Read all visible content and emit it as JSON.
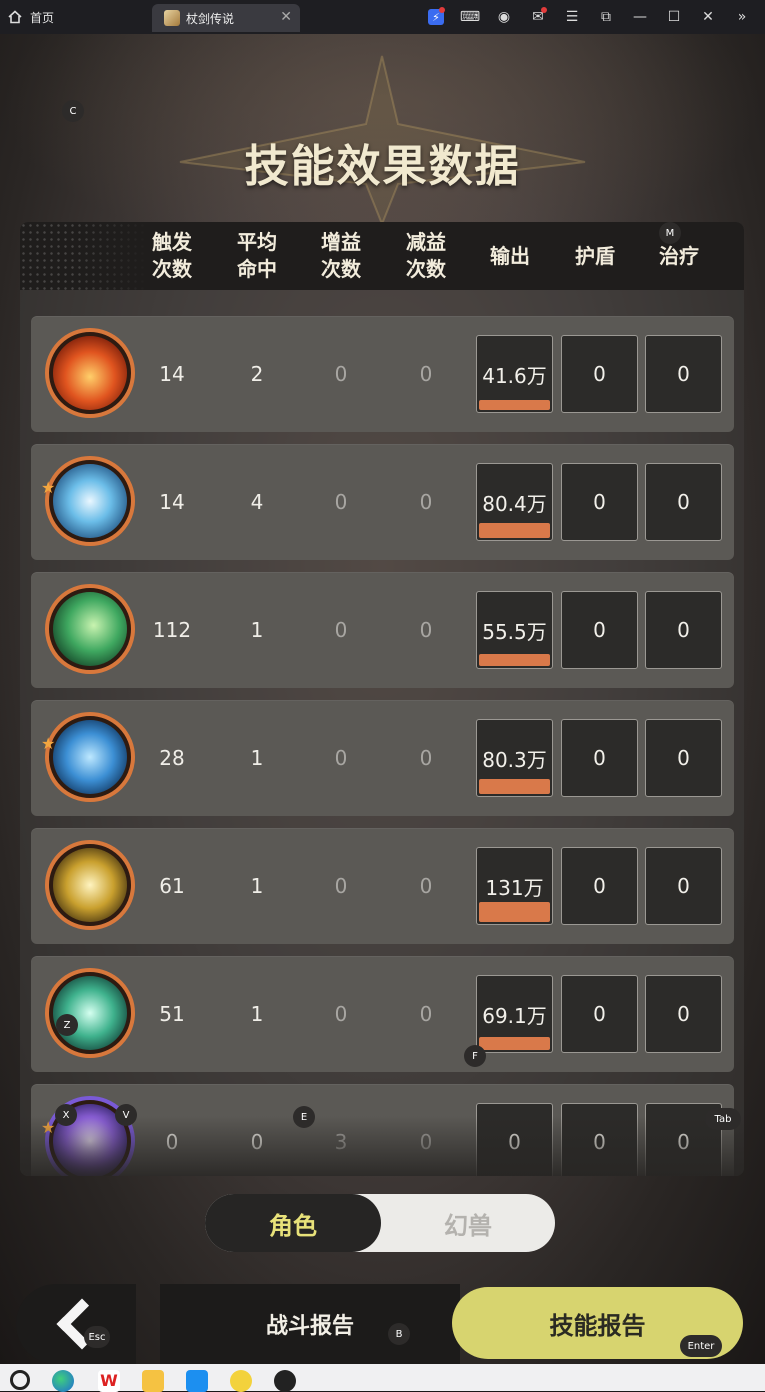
{
  "browser": {
    "home_tab": "首页",
    "game_tab": "杖剑传说"
  },
  "title": "技能效果数据",
  "headers": [
    "触发\n次数",
    "平均\n命中",
    "增益\n次数",
    "减益\n次数",
    "输出",
    "护盾",
    "治疗"
  ],
  "rows": [
    {
      "skill": "fire-skill-icon",
      "trigger": "14",
      "hit": "2",
      "buff": "0",
      "debuff": "0",
      "output": "41.6万",
      "output_ratio": 0.32,
      "shield": "0",
      "heal": "0",
      "star": false
    },
    {
      "skill": "ice-skill-icon",
      "trigger": "14",
      "hit": "4",
      "buff": "0",
      "debuff": "0",
      "output": "80.4万",
      "output_ratio": 0.61,
      "shield": "0",
      "heal": "0",
      "star": true
    },
    {
      "skill": "wind-skill-icon",
      "trigger": "112",
      "hit": "1",
      "buff": "0",
      "debuff": "0",
      "output": "55.5万",
      "output_ratio": 0.42,
      "shield": "0",
      "heal": "0",
      "star": false
    },
    {
      "skill": "water-skill-icon",
      "trigger": "28",
      "hit": "1",
      "buff": "0",
      "debuff": "0",
      "output": "80.3万",
      "output_ratio": 0.61,
      "shield": "0",
      "heal": "0",
      "star": true
    },
    {
      "skill": "lightning-skill-icon",
      "trigger": "61",
      "hit": "1",
      "buff": "0",
      "debuff": "0",
      "output": "131万",
      "output_ratio": 1.0,
      "shield": "0",
      "heal": "0",
      "star": false
    },
    {
      "skill": "nature-skill-icon",
      "trigger": "51",
      "hit": "1",
      "buff": "0",
      "debuff": "0",
      "output": "69.1万",
      "output_ratio": 0.53,
      "shield": "0",
      "heal": "0",
      "star": false
    },
    {
      "skill": "starlight-skill-icon",
      "trigger": "0",
      "hit": "0",
      "buff": "3",
      "debuff": "0",
      "output": "0",
      "output_ratio": 0,
      "shield": "0",
      "heal": "0",
      "star": true
    }
  ],
  "toggle": {
    "active": "角色",
    "inactive": "幻兽"
  },
  "buttons": {
    "battle": "战斗报告",
    "skill": "技能报告"
  },
  "hotkeys": {
    "c": "C",
    "m": "M",
    "z": "Z",
    "f": "F",
    "x": "X",
    "v": "V",
    "e": "E",
    "tab": "Tab",
    "esc": "Esc",
    "b": "B",
    "enter": "Enter"
  },
  "colors": {
    "output_bar": "#d9794a",
    "accent_button": "#d7d46f",
    "toggle_active_text": "#e8e27a"
  }
}
